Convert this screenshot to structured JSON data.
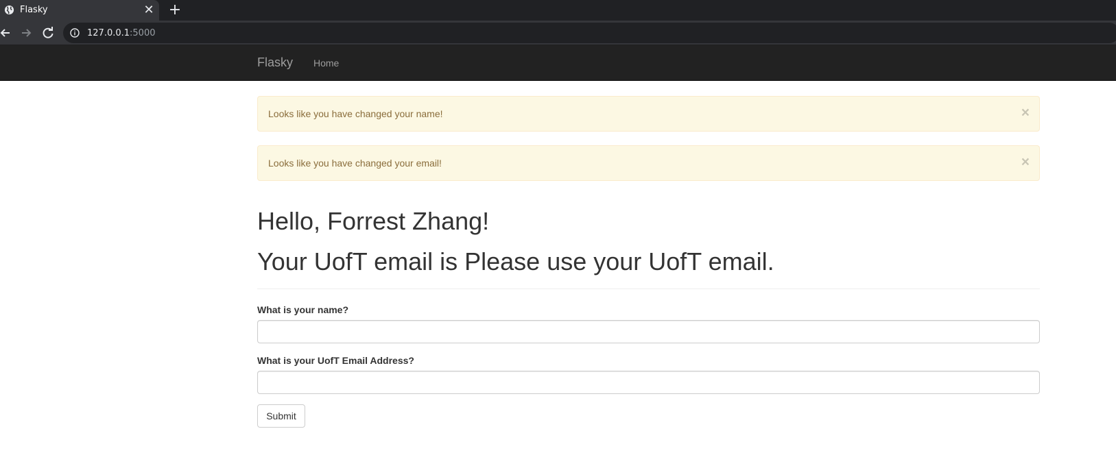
{
  "browser": {
    "tab_title": "Flasky",
    "tab_close_glyph": "✕",
    "new_tab_glyph": "+",
    "url_host": "127.0.0.1",
    "url_port": ":5000"
  },
  "navbar": {
    "brand": "Flasky",
    "home_link": "Home"
  },
  "alerts": [
    {
      "message": "Looks like you have changed your name!",
      "close": "×"
    },
    {
      "message": "Looks like you have changed your email!",
      "close": "×"
    }
  ],
  "main": {
    "greeting": "Hello, Forrest Zhang!",
    "email_line": "Your UofT email is Please use your UofT email."
  },
  "form": {
    "name_label": "What is your name?",
    "name_value": "",
    "email_label": "What is your UofT Email Address?",
    "email_value": "",
    "submit_label": "Submit"
  },
  "colors": {
    "navbar_bg": "#222222",
    "alert_bg": "#fcf8e3",
    "alert_text": "#8a6d3b",
    "heading_text": "#333333"
  }
}
